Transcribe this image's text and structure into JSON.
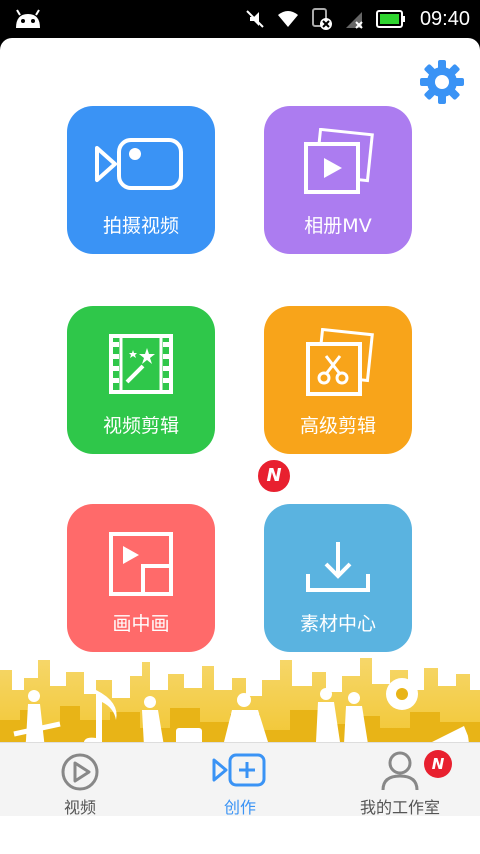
{
  "status_bar": {
    "time": "09:40",
    "icons": [
      "android-icon",
      "mute-icon",
      "wifi-icon",
      "sd-card-icon",
      "signal-icon",
      "battery-icon"
    ]
  },
  "settings": {
    "icon": "gear-icon",
    "color": "#3a93f5"
  },
  "tiles": [
    {
      "label": "拍摄视频",
      "color": "#3a93f5",
      "icon": "video-camera-icon"
    },
    {
      "label": "相册MV",
      "color": "#ac7cf0",
      "icon": "photo-album-icon"
    },
    {
      "label": "视频剪辑",
      "color": "#2fc74a",
      "icon": "film-magic-icon"
    },
    {
      "label": "高级剪辑",
      "color": "#f8a41a",
      "icon": "scissors-photo-icon"
    },
    {
      "label": "画中画",
      "color": "#ff6a6a",
      "icon": "picture-in-picture-icon"
    },
    {
      "label": "素材中心",
      "color": "#5ab3e0",
      "icon": "download-icon",
      "badge": "N"
    }
  ],
  "tabs": [
    {
      "label": "视频",
      "icon": "play-circle-icon",
      "active": false
    },
    {
      "label": "创作",
      "icon": "create-icon",
      "active": true
    },
    {
      "label": "我的工作室",
      "icon": "user-icon",
      "active": false,
      "badge": "N"
    }
  ],
  "colors": {
    "accent": "#3a93f5",
    "badge": "#e8202f",
    "skyline": "#f2c126"
  }
}
